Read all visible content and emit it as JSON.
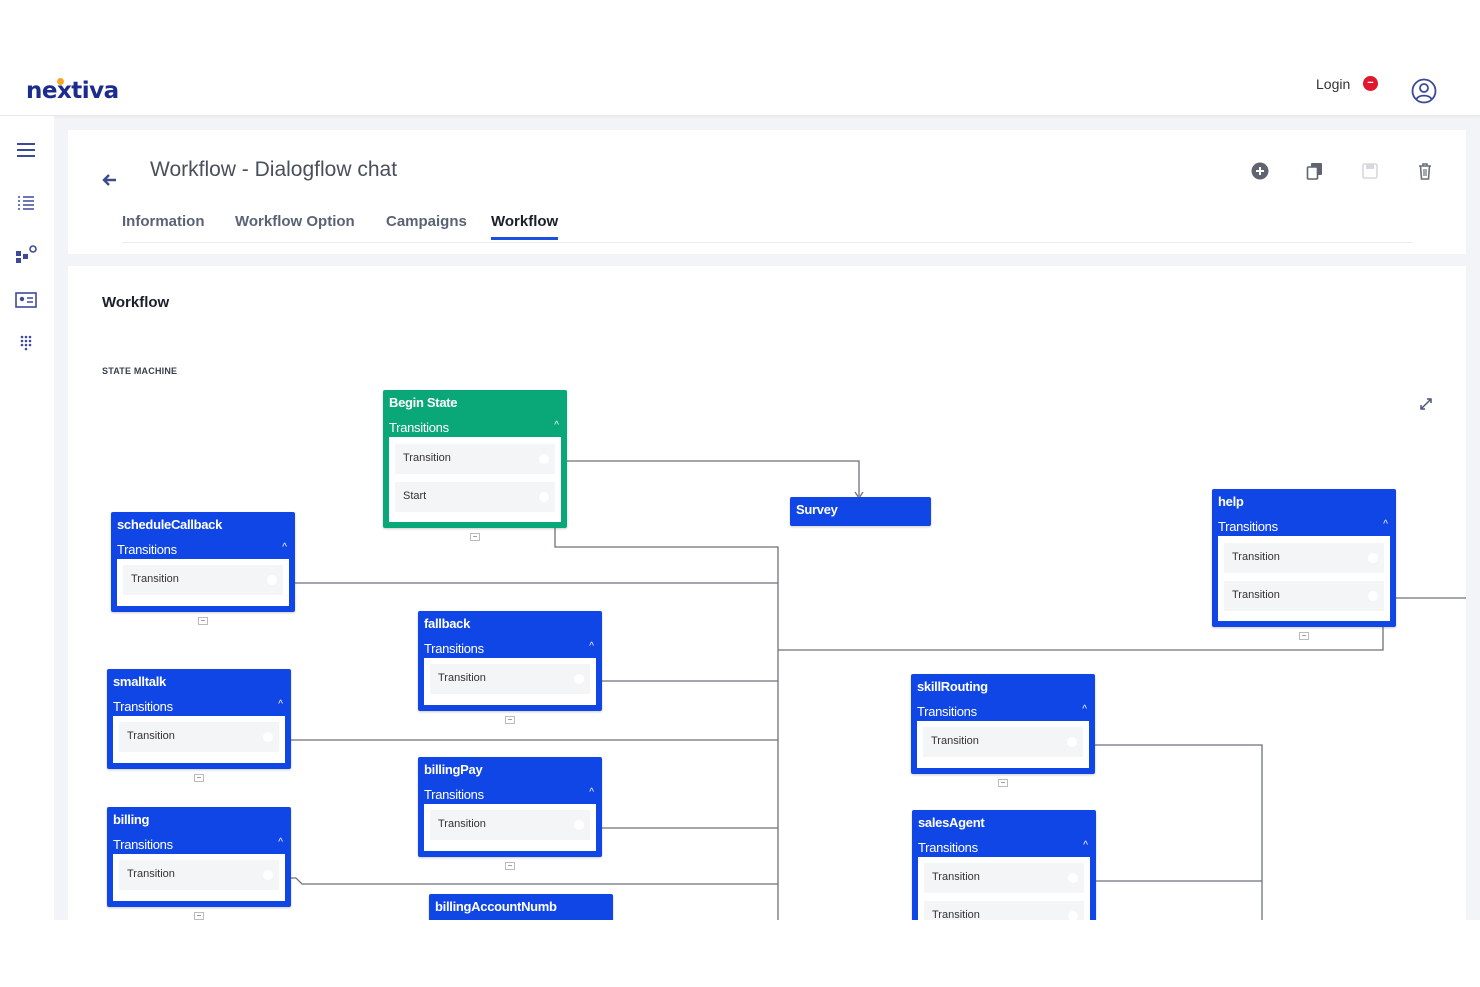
{
  "app": {
    "brand": "nextiva",
    "login_label": "Login",
    "login_status_glyph": "−"
  },
  "sidebar": {
    "icons": [
      "menu-icon",
      "list-icon",
      "routing-icon",
      "contact-card-icon",
      "dialpad-icon"
    ]
  },
  "header": {
    "title": "Workflow - Dialogflow chat",
    "actions": [
      "add-icon",
      "copy-icon",
      "save-icon",
      "delete-icon"
    ]
  },
  "tabs": [
    {
      "label": "Information",
      "active": false
    },
    {
      "label": "Workflow Option",
      "active": false
    },
    {
      "label": "Campaigns",
      "active": false
    },
    {
      "label": "Workflow",
      "active": true
    }
  ],
  "workflow": {
    "section_title": "Workflow",
    "state_machine_label": "STATE MACHINE",
    "collapse_glyph": "−",
    "caret_glyph": "^",
    "transitions_label": "Transitions",
    "nodes": {
      "begin": {
        "name": "Begin State",
        "items": [
          "Transition",
          "Start"
        ]
      },
      "survey": {
        "name": "Survey"
      },
      "scheduleCallback": {
        "name": "scheduleCallback",
        "items": [
          "Transition"
        ]
      },
      "fallback": {
        "name": "fallback",
        "items": [
          "Transition"
        ]
      },
      "smalltalk": {
        "name": "smalltalk",
        "items": [
          "Transition"
        ]
      },
      "billingPay": {
        "name": "billingPay",
        "items": [
          "Transition"
        ]
      },
      "billing": {
        "name": "billing",
        "items": [
          "Transition"
        ]
      },
      "billingAccountNumb": {
        "name": "billingAccountNumb"
      },
      "help": {
        "name": "help",
        "items": [
          "Transition",
          "Transition"
        ]
      },
      "skillRouting": {
        "name": "skillRouting",
        "items": [
          "Transition"
        ]
      },
      "salesAgent": {
        "name": "salesAgent",
        "items": [
          "Transition",
          "Transition"
        ]
      }
    }
  },
  "colors": {
    "node_blue": "#1146e6",
    "node_green": "#0aa878",
    "tab_underline": "#1a50e0",
    "status_red": "#e0182d"
  }
}
